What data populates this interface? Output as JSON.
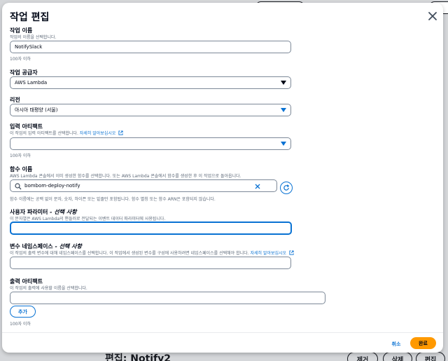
{
  "background": {
    "page_title": "편집: Notify2",
    "buttons": [
      "제거",
      "삭제",
      "편집"
    ]
  },
  "modal": {
    "title": "작업 편집",
    "fields": {
      "action_name": {
        "label": "작업 이름",
        "description": "작업의 이름을 선택합니다.",
        "value": "NotifySlack",
        "hint": "100자 이하"
      },
      "action_provider": {
        "label": "작업 공급자",
        "value": "AWS Lambda"
      },
      "region": {
        "label": "리전",
        "value": "아시아 태평양 (서울)"
      },
      "input_artifacts": {
        "label": "입력 아티팩트",
        "description": "이 작업의 입력 아티팩트를 선택합니다.",
        "link": "자세히 알아보십시오",
        "value": "",
        "hint": "100자 이하"
      },
      "function_name": {
        "label": "함수 이름",
        "description": "AWS Lambda 콘솔에서 이미 생성한 함수를 선택합니다. 또는 AWS Lambda 콘솔에서 함수를 생성한 후 이 작업으로 돌아옵니다.",
        "value": "bombom-deploy-notify",
        "hint": "함수 이름에는 공백 없이 문자, 숫자, 하이픈 또는 밑줄만 포함됩니다. 함수 별칭 또는 함수 ARN은 포함되지 않습니다."
      },
      "user_parameters": {
        "label": "사용자 파라미터",
        "label_optional": "- 선택 사항",
        "description": "이 문자열은 AWS Lambda의 핸들러로 전달되는 이벤트 데이터 파라미터에 사용됩니다.",
        "value": ""
      },
      "variable_namespace": {
        "label": "변수 네임스페이스",
        "label_optional": "- 선택 사항",
        "description": "이 작업의 출력 변수에 대해 네임스페이스를 선택합니다. 이 작업에서 생성된 변수를 구성에 사용하려면 네임스페이스를 선택해야 합니다.",
        "link": "자세히 알아보십시오",
        "value": ""
      },
      "output_artifacts": {
        "label": "출력 아티팩트",
        "description": "이 작업의 출력에 사용할 이름을 선택합니다.",
        "value": "",
        "add_label": "추가",
        "hint": "100자 이하"
      }
    },
    "footer": {
      "cancel_label": "취소",
      "done_label": "완료"
    }
  },
  "colors": {
    "primary": "#0972d3",
    "accent": "#ff9900",
    "text": "#000716",
    "muted": "#5f6b7a"
  },
  "icons": [
    "close-icon",
    "chevron-down-icon",
    "external-link-icon",
    "search-icon",
    "clear-icon",
    "refresh-icon"
  ]
}
